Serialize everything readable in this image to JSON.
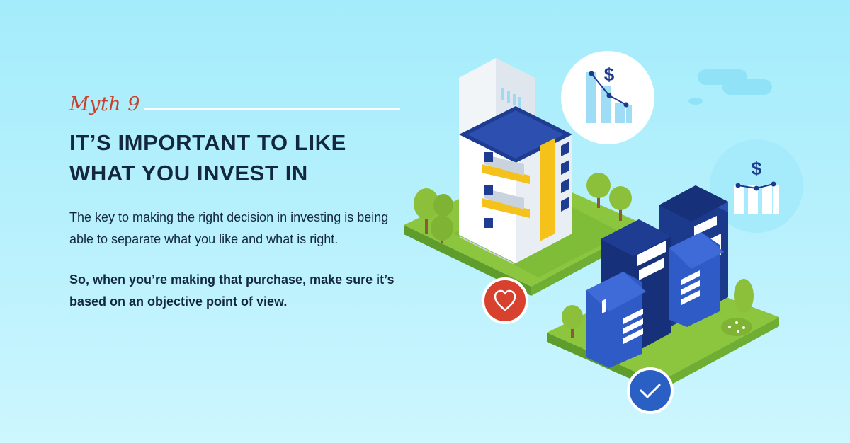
{
  "myth": {
    "label": "Myth 9"
  },
  "title": {
    "line1": "IT’S IMPORTANT TO LIKE",
    "line2": "WHAT YOU INVEST IN"
  },
  "body": {
    "paragraph": "The key to making the right decision in investing is being able to separate what you like and what is right.",
    "emphasis": "So, when you’re making that purchase, make sure it’s based on an objective point of view."
  },
  "illustration": {
    "badge_top_symbol": "$",
    "badge_right_symbol": "$",
    "heart_badge_icon": "heart-icon",
    "check_badge_icon": "check-icon",
    "colors": {
      "heart_badge": "#d8412d",
      "check_badge": "#2a5fc4",
      "navy": "#1b3a8c",
      "grass": "#8cc63f",
      "yellow": "#f5c11b"
    }
  }
}
